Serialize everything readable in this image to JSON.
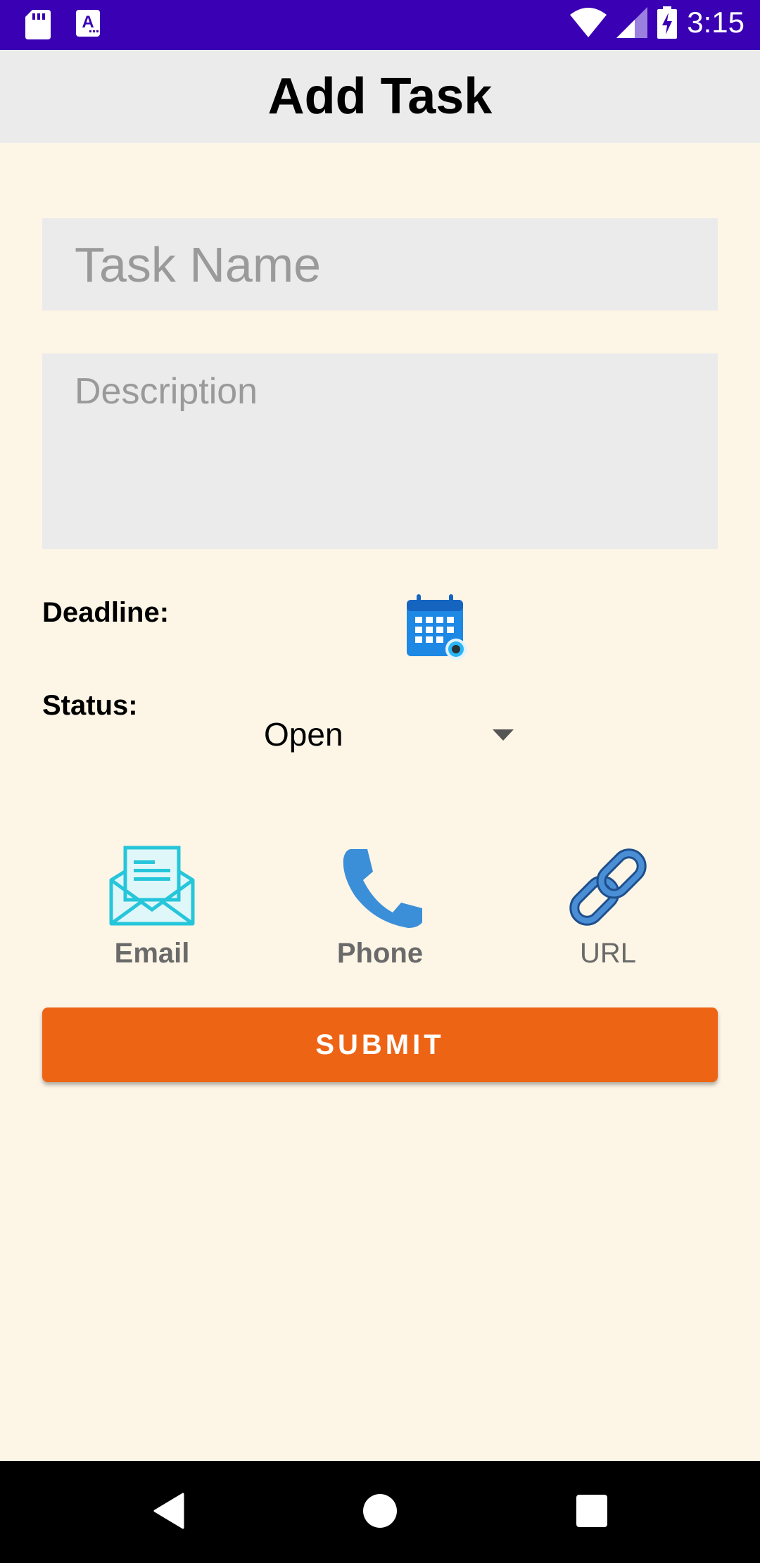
{
  "status_bar": {
    "time": "3:15",
    "icons": [
      "sd-card-icon",
      "a-notification-icon",
      "wifi-icon",
      "signal-icon",
      "battery-charging-icon"
    ]
  },
  "app_bar": {
    "title": "Add Task"
  },
  "form": {
    "task_name_placeholder": "Task Name",
    "description_placeholder": "Description",
    "deadline_label": "Deadline:",
    "status_label": "Status:",
    "status_value": "Open"
  },
  "contacts": [
    {
      "label": "Email",
      "icon": "email-icon"
    },
    {
      "label": "Phone",
      "icon": "phone-icon"
    },
    {
      "label": "URL",
      "icon": "link-icon"
    }
  ],
  "submit_label": "SUBMIT",
  "colors": {
    "status_bar": "#3a00b3",
    "background": "#fdf5e6",
    "submit": "#ed6415",
    "field": "#ebebeb"
  }
}
